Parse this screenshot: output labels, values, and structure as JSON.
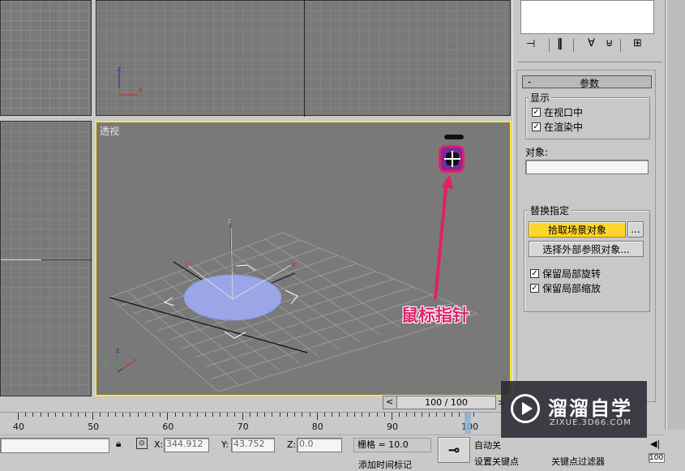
{
  "viewport": {
    "persp_label": "透视",
    "axis_x": "x",
    "axis_y": "y",
    "axis_z": "z"
  },
  "annotation": {
    "text": "鼠标指针",
    "color": "#e0206a"
  },
  "params": {
    "title_minus": "-",
    "title": "参数",
    "display_legend": "显示",
    "cb_viewport": "在视口中",
    "cb_render": "在渲染中",
    "object_label": "对象:",
    "object_value": "",
    "replace_legend": "替换指定",
    "pick_scene_btn": "拾取场景对象",
    "ellipsis_btn": "...",
    "select_external_btn": "选择外部参照对象...",
    "cb_keep_rotation": "保留局部旋转",
    "cb_keep_scale": "保留局部缩放",
    "check_mark": "✓"
  },
  "timeslider": {
    "value": "100 / 100",
    "left_arrow": "<",
    "right_arrow": ">"
  },
  "timeline": {
    "ticks": [
      "40",
      "50",
      "60",
      "70",
      "80",
      "90",
      "100"
    ]
  },
  "status": {
    "x_label": "X:",
    "x_value": "344.912",
    "y_label": "Y:",
    "y_value": "43.752",
    "z_label": "Z:",
    "z_value": "0.0",
    "grid": "栅格 = 10.0",
    "auto_key": "自动关",
    "set_key": "设置关键点",
    "key_filters": "关键点过滤器",
    "add_time_tag": "添加时间标记",
    "frame": "100"
  },
  "watermark": {
    "title": "溜溜自学",
    "url": "ZIXUE.3D66.COM"
  },
  "accent": "#ffd52b"
}
